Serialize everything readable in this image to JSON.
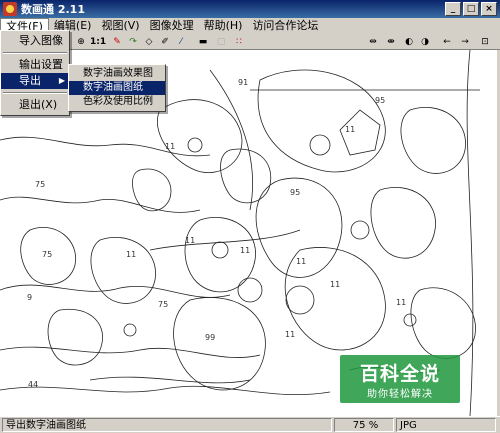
{
  "window": {
    "title": "数画通 2.11",
    "minimize": "_",
    "maximize": "□",
    "close": "×"
  },
  "menubar": {
    "items": [
      "文件(F)",
      "编辑(E)",
      "视图(V)",
      "图像处理",
      "帮助(H)",
      "访问合作论坛"
    ]
  },
  "toolbar": {
    "icons": [
      "new-icon",
      "open-icon",
      "zoom-in-icon",
      "zoom-out-icon",
      "actual-size-icon",
      "pencil-icon",
      "redo-icon",
      "lasso-icon",
      "pen-icon",
      "eyedropper-icon",
      "brush-icon",
      "selection-icon",
      "grid-icon",
      "align-left-icon",
      "align-center-icon",
      "flip-icon",
      "rotate-icon",
      "undo-icon",
      "redo-arrow-icon",
      "fit-icon"
    ],
    "labels": {
      "actual_size": "1:1"
    }
  },
  "file_menu": {
    "items": [
      {
        "label": "导入图像"
      },
      {
        "label": "输出设置"
      },
      {
        "label": "导出",
        "submenu": true
      },
      {
        "label": "退出(X)"
      }
    ]
  },
  "export_submenu": {
    "items": [
      "数字油画效果图",
      "数字油画图纸",
      "色彩及使用比例"
    ],
    "highlighted_index": 1
  },
  "canvas": {
    "region_numbers": [
      "91",
      "95",
      "11",
      "75",
      "11",
      "95",
      "11",
      "75",
      "11",
      "11",
      "11",
      "11",
      "9",
      "99",
      "44",
      "11",
      "11",
      "75"
    ]
  },
  "statusbar": {
    "message": "导出数字油画图纸",
    "zoom": "75 %",
    "format": "JPG"
  },
  "watermark": {
    "title": "百科全说",
    "subtitle": "助你轻松解决"
  },
  "colors": {
    "titlebar": "#0a246a",
    "highlight": "#0a246a",
    "chrome": "#d4d0c8",
    "watermark": "#1e963c"
  }
}
